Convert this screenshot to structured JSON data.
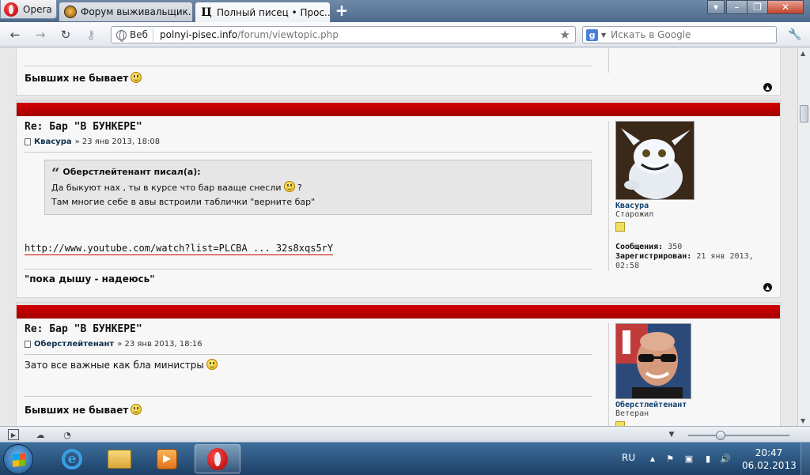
{
  "browser": {
    "menu_label": "Opera",
    "tabs": [
      {
        "title": "Форум выживальщик...",
        "active": false
      },
      {
        "title": "Полный писец • Прос...",
        "active": true
      }
    ],
    "new_tab": "+",
    "address": {
      "badge": "Веб",
      "url_host": "polnyi-pisec.info",
      "url_path": "/forum/viewtopic.php"
    },
    "search": {
      "placeholder": "Искать в Google",
      "engine": "g"
    }
  },
  "posts": [
    {
      "partial": true,
      "signature": "Бывших не бывает"
    },
    {
      "title": "Re: Бар \"В БУНКЕРЕ\"",
      "author": "Квасура",
      "date": "» 23 янв 2013, 18:08",
      "quote": {
        "header": "Оберстлейтенант писал(а):",
        "line1": "Да быкуют нах , ты в курсе что бар вааще снесли",
        "line1_tail": "?",
        "line2": "Там многие себе в авы встроили таблички \"верните бар\""
      },
      "link": "http://www.youtube.com/watch?list=PLCBA ... 32s8xqs5rY",
      "signature": "\"пока дышу - надеюсь\"",
      "profile": {
        "name": "Квасура",
        "rank": "Старожил",
        "messages_label": "Сообщения:",
        "messages": "350",
        "registered_label": "Зарегистрирован:",
        "registered": "21 янв 2013, 02:58"
      }
    },
    {
      "title": "Re: Бар \"В БУНКЕРЕ\"",
      "author": "Оберстлейтенант",
      "date": "» 23 янв 2013, 18:16",
      "text": "Зато все важные как бла министры",
      "signature": "Бывших не бывает",
      "profile": {
        "name": "Оберстлейтенант",
        "rank": "Ветеран"
      }
    }
  ],
  "taskbar": {
    "lang": "RU",
    "time": "20:47",
    "date": "06.02.2013"
  },
  "colors": {
    "post_header": "#b80000",
    "link_underline": "#cc0000",
    "author": "#0f2f4f"
  }
}
